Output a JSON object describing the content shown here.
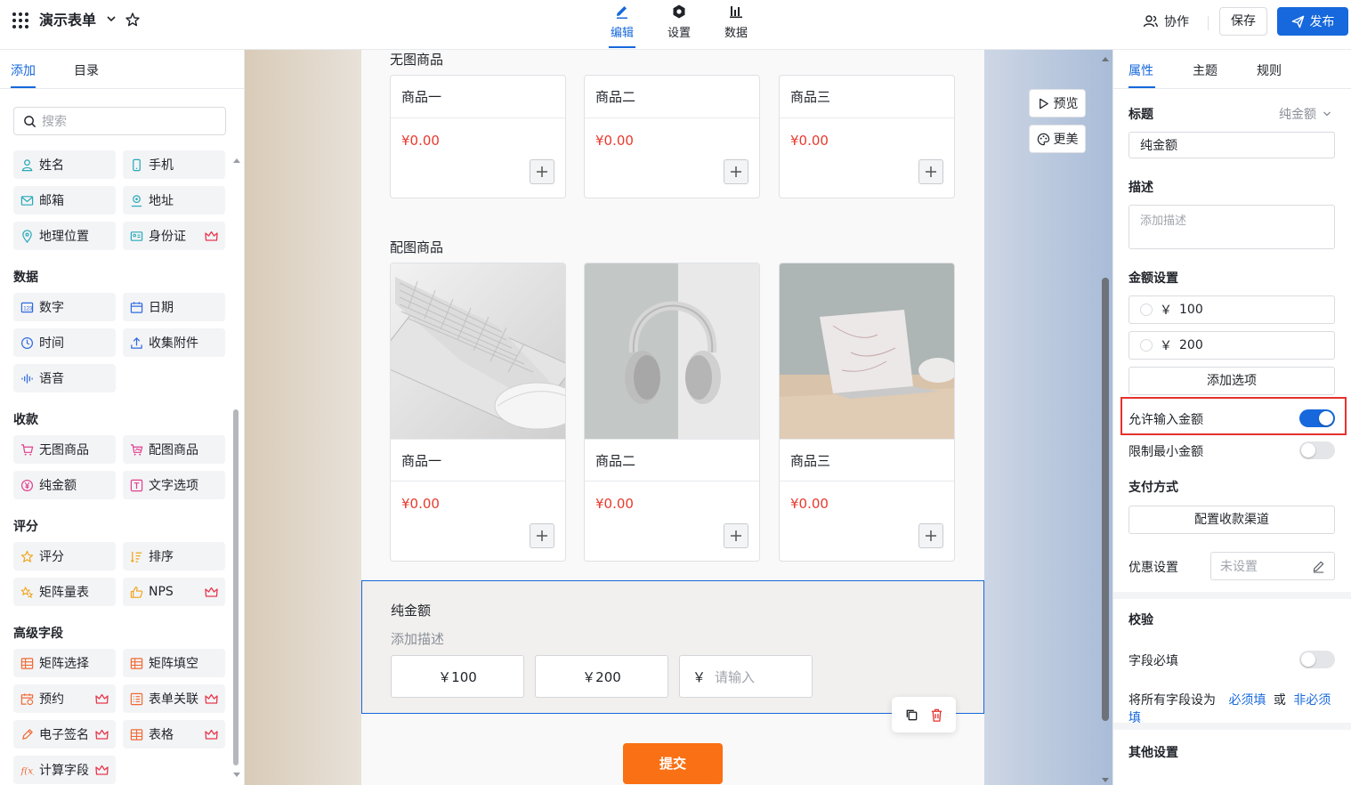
{
  "header": {
    "app_title": "演示表单",
    "nav_tabs": [
      {
        "label": "编辑",
        "icon": "pencil-icon",
        "active": true
      },
      {
        "label": "设置",
        "icon": "hexagon-settings-icon",
        "active": false
      },
      {
        "label": "数据",
        "icon": "bar-chart-icon",
        "active": false
      }
    ],
    "collab_label": "协作",
    "save_label": "保存",
    "publish_label": "发布"
  },
  "left_panel": {
    "tabs": [
      {
        "label": "添加",
        "active": true
      },
      {
        "label": "目录",
        "active": false
      }
    ],
    "search_placeholder": "搜索",
    "basic_items": [
      {
        "label": "姓名",
        "icon": "person-icon",
        "pro": false
      },
      {
        "label": "手机",
        "icon": "phone-icon",
        "pro": false
      },
      {
        "label": "邮箱",
        "icon": "mail-icon",
        "pro": false
      },
      {
        "label": "地址",
        "icon": "address-icon",
        "pro": false
      },
      {
        "label": "地理位置",
        "icon": "location-pin-icon",
        "pro": false
      },
      {
        "label": "身份证",
        "icon": "id-card-icon",
        "pro": true
      }
    ],
    "sections": [
      {
        "title": "数据",
        "items": [
          {
            "label": "数字",
            "icon": "number-icon",
            "pro": false
          },
          {
            "label": "日期",
            "icon": "calendar-icon",
            "pro": false
          },
          {
            "label": "时间",
            "icon": "clock-icon",
            "pro": false
          },
          {
            "label": "收集附件",
            "icon": "upload-icon",
            "pro": false
          },
          {
            "label": "语音",
            "icon": "voice-wave-icon",
            "pro": false
          }
        ]
      },
      {
        "title": "收款",
        "items": [
          {
            "label": "无图商品",
            "icon": "cart-icon",
            "pro": false
          },
          {
            "label": "配图商品",
            "icon": "cart-image-icon",
            "pro": false
          },
          {
            "label": "纯金额",
            "icon": "yuan-icon",
            "pro": false
          },
          {
            "label": "文字选项",
            "icon": "text-box-icon",
            "pro": false
          }
        ]
      },
      {
        "title": "评分",
        "items": [
          {
            "label": "评分",
            "icon": "star-icon",
            "pro": false
          },
          {
            "label": "排序",
            "icon": "sort-icon",
            "pro": false
          },
          {
            "label": "矩阵量表",
            "icon": "stars-icon",
            "pro": false
          },
          {
            "label": "NPS",
            "icon": "thumbs-up-icon",
            "pro": true
          }
        ]
      },
      {
        "title": "高级字段",
        "items": [
          {
            "label": "矩阵选择",
            "icon": "table-grid-icon",
            "pro": false
          },
          {
            "label": "矩阵填空",
            "icon": "table-grid-icon",
            "pro": false
          },
          {
            "label": "预约",
            "icon": "calendar-clock-icon",
            "pro": true
          },
          {
            "label": "表单关联",
            "icon": "form-link-icon",
            "pro": true
          },
          {
            "label": "电子签名",
            "icon": "pen-sign-icon",
            "pro": true
          },
          {
            "label": "表格",
            "icon": "table-icon",
            "pro": true
          },
          {
            "label": "计算字段",
            "icon": "function-icon",
            "pro": true
          }
        ]
      }
    ]
  },
  "form": {
    "group1_label": "无图商品",
    "group1_products": [
      {
        "name": "商品一",
        "price": "¥0.00"
      },
      {
        "name": "商品二",
        "price": "¥0.00"
      },
      {
        "name": "商品三",
        "price": "¥0.00"
      }
    ],
    "group2_label": "配图商品",
    "group2_products": [
      {
        "name": "商品一",
        "price": "¥0.00",
        "image": "keyboard-mouse-photo"
      },
      {
        "name": "商品二",
        "price": "¥0.00",
        "image": "headphones-photo"
      },
      {
        "name": "商品三",
        "price": "¥0.00",
        "image": "laptop-photo"
      }
    ],
    "amount_field": {
      "title": "纯金额",
      "description_placeholder": "添加描述",
      "options": [
        "￥100",
        "￥200"
      ],
      "currency_symbol": "￥",
      "input_placeholder": "请输入"
    },
    "submit_label": "提交"
  },
  "canvas_tools": {
    "preview_label": "预览",
    "beautify_label": "更美"
  },
  "right_panel": {
    "tabs": [
      {
        "label": "属性",
        "active": true
      },
      {
        "label": "主题",
        "active": false
      },
      {
        "label": "规则",
        "active": false
      }
    ],
    "title_label": "标题",
    "field_type_select": "纯金额",
    "title_value": "纯金额",
    "desc_label": "描述",
    "desc_placeholder": "添加描述",
    "amount_settings_label": "金额设置",
    "amount_options": [
      {
        "currency": "￥",
        "value": "100"
      },
      {
        "currency": "￥",
        "value": "200"
      }
    ],
    "add_option_label": "添加选项",
    "allow_input_label": "允许输入金额",
    "allow_input_on": true,
    "limit_min_label": "限制最小金额",
    "limit_min_on": false,
    "payment_label": "支付方式",
    "payment_button": "配置收款渠道",
    "discount_label": "优惠设置",
    "discount_value": "未设置",
    "validation_label": "校验",
    "required_label": "字段必填",
    "required_on": false,
    "set_all_prefix": "将所有字段设为",
    "set_all_required": "必须填",
    "set_all_or": "或",
    "set_all_optional": "非必须填",
    "other_label": "其他设置"
  },
  "colors": {
    "accent": "#1668dc",
    "price_red": "#e83a2e",
    "submit_orange": "#fa7014",
    "highlight_red": "#e5322d",
    "pro_crown": "#e8374c"
  }
}
